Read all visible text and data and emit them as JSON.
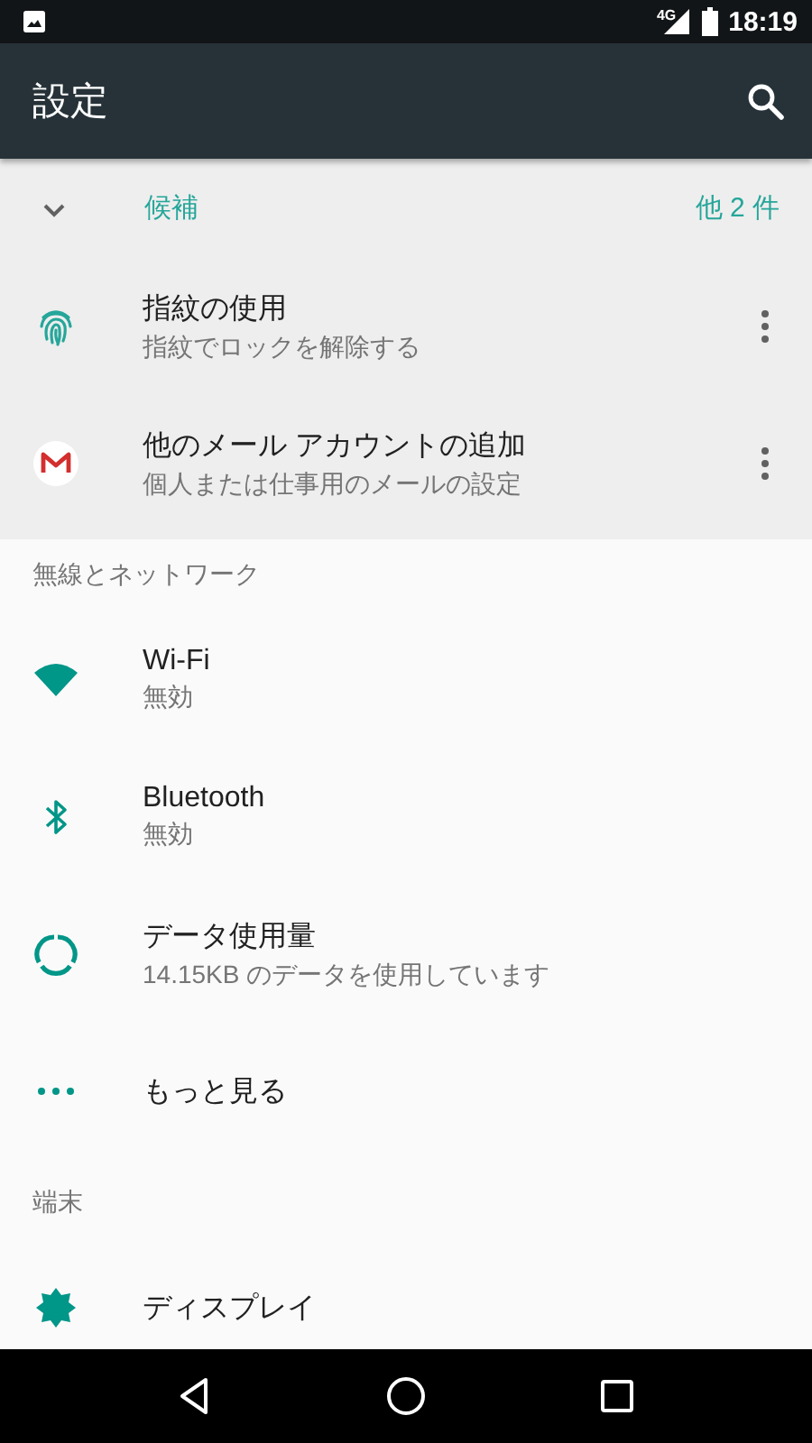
{
  "status_bar": {
    "network": "4G",
    "time": "18:19"
  },
  "toolbar": {
    "title": "設定"
  },
  "suggestions": {
    "label": "候補",
    "count": "他 2 件",
    "expanded": true,
    "items": [
      {
        "kind": "fingerprint",
        "title": "指紋の使用",
        "subtitle": "指紋でロックを解除する"
      },
      {
        "kind": "mail",
        "title": "他のメール アカウントの追加",
        "subtitle": "個人または仕事用のメールの設定"
      }
    ]
  },
  "categories": [
    {
      "title": "無線とネットワーク",
      "items": [
        {
          "kind": "wifi",
          "title": "Wi-Fi",
          "subtitle": "無効"
        },
        {
          "kind": "bluetooth",
          "title": "Bluetooth",
          "subtitle": "無効"
        },
        {
          "kind": "data",
          "title": "データ使用量",
          "subtitle": "14.15KB のデータを使用しています"
        },
        {
          "kind": "more",
          "title": "もっと見る"
        }
      ]
    },
    {
      "title": "端末",
      "items": [
        {
          "kind": "display",
          "title": "ディスプレイ"
        }
      ]
    }
  ]
}
